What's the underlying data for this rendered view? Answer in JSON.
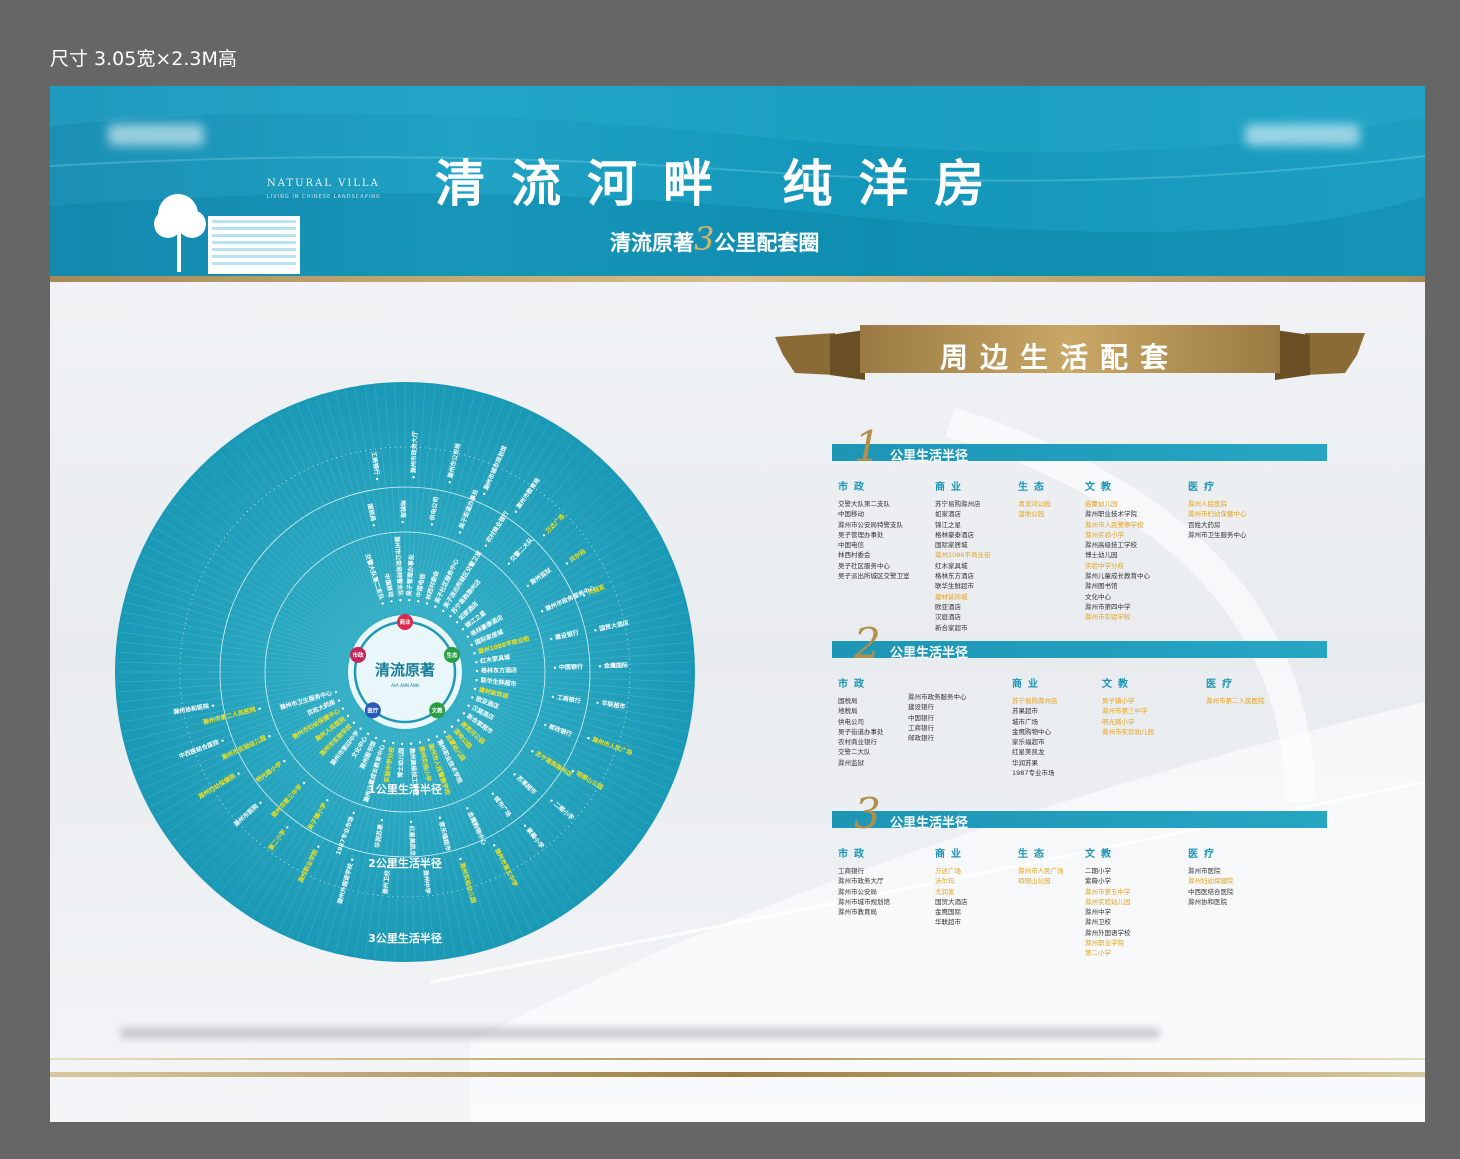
{
  "size_label": "尺寸 3.05宽×2.3M高",
  "banner": {
    "title": "清流河畔  纯洋房",
    "subtitle_pre": "清流原著",
    "subtitle_num": "3",
    "subtitle_post": "公里配套圈",
    "logo_text": "NATURAL VILLA",
    "logo_sub": "LIVING IN CHINESE LANDSCAPING"
  },
  "panel_title": "周边生活配套",
  "wheel": {
    "center_label": "清流原著",
    "center_sub": "AVA ANN ANN",
    "ring_labels": [
      "1公里生活半径",
      "2公里生活半径",
      "3公里生活半径"
    ],
    "categories": [
      "商业",
      "生态",
      "文教",
      "医疗",
      "市政"
    ]
  },
  "sections": [
    {
      "num": "1",
      "title": "公里生活半径",
      "columns": [
        {
          "header": "市政",
          "items": [
            {
              "t": "交警大队第二支队",
              "hl": false
            },
            {
              "t": "中国移动",
              "hl": false
            },
            {
              "t": "滁州市公安局特警支队",
              "hl": false
            },
            {
              "t": "吴子管理办事处",
              "hl": false
            },
            {
              "t": "中国电信",
              "hl": false
            },
            {
              "t": "林西村委会",
              "hl": false
            },
            {
              "t": "吴子社区服务中心",
              "hl": false
            },
            {
              "t": "吴子派出所城区交警卫室",
              "hl": false
            }
          ]
        },
        {
          "header": "商业",
          "items": [
            {
              "t": "苏宁易购滁州店",
              "hl": false
            },
            {
              "t": "如家酒店",
              "hl": false
            },
            {
              "t": "锦江之星",
              "hl": false
            },
            {
              "t": "格林豪泰酒店",
              "hl": false
            },
            {
              "t": "国际家居城",
              "hl": false
            },
            {
              "t": "滁州1088平商业街",
              "hl": true
            },
            {
              "t": "红木家具城",
              "hl": false
            },
            {
              "t": "格林东方酒店",
              "hl": false
            },
            {
              "t": "联华生鲜超市",
              "hl": false
            },
            {
              "t": "建材装饰城",
              "hl": true
            },
            {
              "t": "欧亚酒店",
              "hl": false
            },
            {
              "t": "汉庭酒店",
              "hl": false
            },
            {
              "t": "新合家超市",
              "hl": false
            }
          ]
        },
        {
          "header": "生态",
          "items": [
            {
              "t": "清流河公园",
              "hl": true
            },
            {
              "t": "湿地公园",
              "hl": true
            }
          ]
        },
        {
          "header": "文教",
          "items": [
            {
              "t": "启蒙幼儿园",
              "hl": true
            },
            {
              "t": "滁州职业技术学院",
              "hl": false
            },
            {
              "t": "滁州市人民警察学校",
              "hl": true
            },
            {
              "t": "滁州实验小学",
              "hl": true
            },
            {
              "t": "滁州高级技工学校",
              "hl": false
            },
            {
              "t": "博士幼儿园",
              "hl": false
            },
            {
              "t": "实验中学分校",
              "hl": true
            },
            {
              "t": "滁州儿童成长教育中心",
              "hl": false
            },
            {
              "t": "滁州图书馆",
              "hl": false
            },
            {
              "t": "文化中心",
              "hl": false
            },
            {
              "t": "滁州市第四中学",
              "hl": false
            },
            {
              "t": "滁州市实验学校",
              "hl": true
            }
          ]
        },
        {
          "header": "医疗",
          "items": [
            {
              "t": "滁州人民医院",
              "hl": true
            },
            {
              "t": "滁州市妇幼保健中心",
              "hl": true
            },
            {
              "t": "百姓大药房",
              "hl": false
            },
            {
              "t": "滁州市卫生服务中心",
              "hl": false
            }
          ]
        }
      ]
    },
    {
      "num": "2",
      "title": "公里生活半径",
      "columns": [
        {
          "header": "市政",
          "items": [
            {
              "t": "国税局",
              "hl": false
            },
            {
              "t": "地税局",
              "hl": false
            },
            {
              "t": "供电公司",
              "hl": false
            },
            {
              "t": "吴子街道办事处",
              "hl": false
            },
            {
              "t": "农村商业银行",
              "hl": false
            },
            {
              "t": "交警二大队",
              "hl": false
            },
            {
              "t": "滁州监狱",
              "hl": false
            }
          ]
        },
        {
          "header": "",
          "items": [
            {
              "t": "滁州市政务服务中心",
              "hl": false
            },
            {
              "t": "建设银行",
              "hl": false
            },
            {
              "t": "中国银行",
              "hl": false
            },
            {
              "t": "工商银行",
              "hl": false
            },
            {
              "t": "邮政银行",
              "hl": false
            }
          ]
        },
        {
          "header": "商业",
          "items": [
            {
              "t": "苏宁易购滁州店",
              "hl": true
            },
            {
              "t": "苏果超市",
              "hl": false
            },
            {
              "t": "城市广场",
              "hl": false
            },
            {
              "t": "金鹰购物中心",
              "hl": false
            },
            {
              "t": "家乐福超市",
              "hl": false
            },
            {
              "t": "红星美凯龙",
              "hl": false
            },
            {
              "t": "华润苏果",
              "hl": false
            },
            {
              "t": "1987专业市场",
              "hl": false
            }
          ]
        },
        {
          "header": "文教",
          "items": [
            {
              "t": "吴子镇小学",
              "hl": true
            },
            {
              "t": "滁州市第三中学",
              "hl": true
            },
            {
              "t": "明光路小学",
              "hl": true
            },
            {
              "t": "滁州市实验幼儿园",
              "hl": true
            }
          ]
        },
        {
          "header": "医疗",
          "items": [
            {
              "t": "滁州市第二人民医院",
              "hl": true
            }
          ]
        }
      ]
    },
    {
      "num": "3",
      "title": "公里生活半径",
      "columns": [
        {
          "header": "市政",
          "items": [
            {
              "t": "工商银行",
              "hl": false
            },
            {
              "t": "滁州市政务大厅",
              "hl": false
            },
            {
              "t": "滁州市公安局",
              "hl": false
            },
            {
              "t": "滁州市城市规划馆",
              "hl": false
            },
            {
              "t": "滁州市教育局",
              "hl": false
            }
          ]
        },
        {
          "header": "商业",
          "items": [
            {
              "t": "万达广场",
              "hl": true
            },
            {
              "t": "沃尔玛",
              "hl": true
            },
            {
              "t": "大润发",
              "hl": true
            },
            {
              "t": "国贸大酒店",
              "hl": false
            },
            {
              "t": "金鹰国际",
              "hl": false
            },
            {
              "t": "华联超市",
              "hl": false
            }
          ]
        },
        {
          "header": "生态",
          "items": [
            {
              "t": "滁州市人民广场",
              "hl": true
            },
            {
              "t": "琅琊山公园",
              "hl": true
            }
          ]
        },
        {
          "header": "文教",
          "items": [
            {
              "t": "二期小学",
              "hl": false
            },
            {
              "t": "紫薇小学",
              "hl": false
            },
            {
              "t": "滁州市第五中学",
              "hl": true
            },
            {
              "t": "滁州实验幼儿园",
              "hl": true
            },
            {
              "t": "滁州中学",
              "hl": false
            },
            {
              "t": "滁州卫校",
              "hl": false
            },
            {
              "t": "滁州外国语学校",
              "hl": false
            },
            {
              "t": "滁州职业学院",
              "hl": true
            },
            {
              "t": "第二小学",
              "hl": true
            }
          ]
        },
        {
          "header": "医疗",
          "items": [
            {
              "t": "滁州市医院",
              "hl": false
            },
            {
              "t": "滁州妇幼保健院",
              "hl": true
            },
            {
              "t": "中西医结合医院",
              "hl": false
            },
            {
              "t": "滁州协和医院",
              "hl": false
            }
          ]
        }
      ]
    }
  ],
  "colors": {
    "teal": "#1d9fc2",
    "gold": "#b38f4a",
    "highlight": "#e8a11a",
    "wheel_fill": "#20a2bd"
  }
}
